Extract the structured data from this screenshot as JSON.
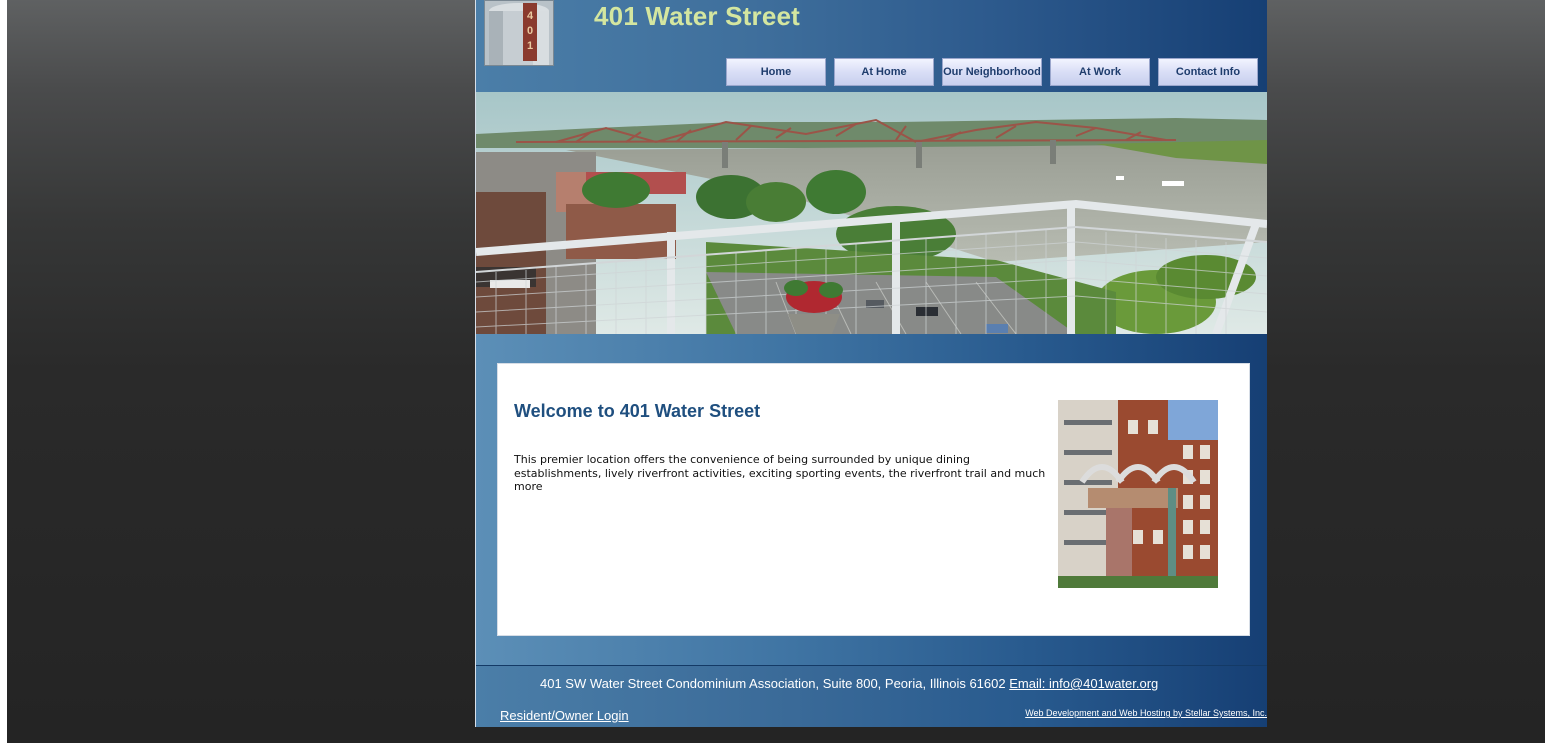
{
  "header": {
    "title": "401 Water Street",
    "logo_icon": "water-tower-logo-icon",
    "nav": [
      {
        "label": "Home"
      },
      {
        "label": "At Home"
      },
      {
        "label": "Our Neighborhood"
      },
      {
        "label": "At Work"
      },
      {
        "label": "Contact Info"
      }
    ]
  },
  "hero": {
    "image": "riverfront-bridge-balcony-photo"
  },
  "main": {
    "heading": "Welcome to 401 Water Street",
    "body": "This premier location offers the convenience of being surrounded by unique dining establishments, lively riverfront activities, exciting sporting events, the riverfront trail and much more",
    "image": "building-sculpture-photo"
  },
  "footer": {
    "address": "401 SW Water Street Condominium Association, Suite 800, Peoria, Illinois 61602",
    "email_label": "Email: info@401water.org",
    "login_label": "Resident/Owner Login",
    "credit_label": "Web Development and Web Hosting by Stellar Systems, Inc."
  },
  "colors": {
    "title": "#d4e6a0",
    "heading": "#1f4f7f",
    "header_dark": "#163f74",
    "header_light": "#4b7ea8"
  }
}
